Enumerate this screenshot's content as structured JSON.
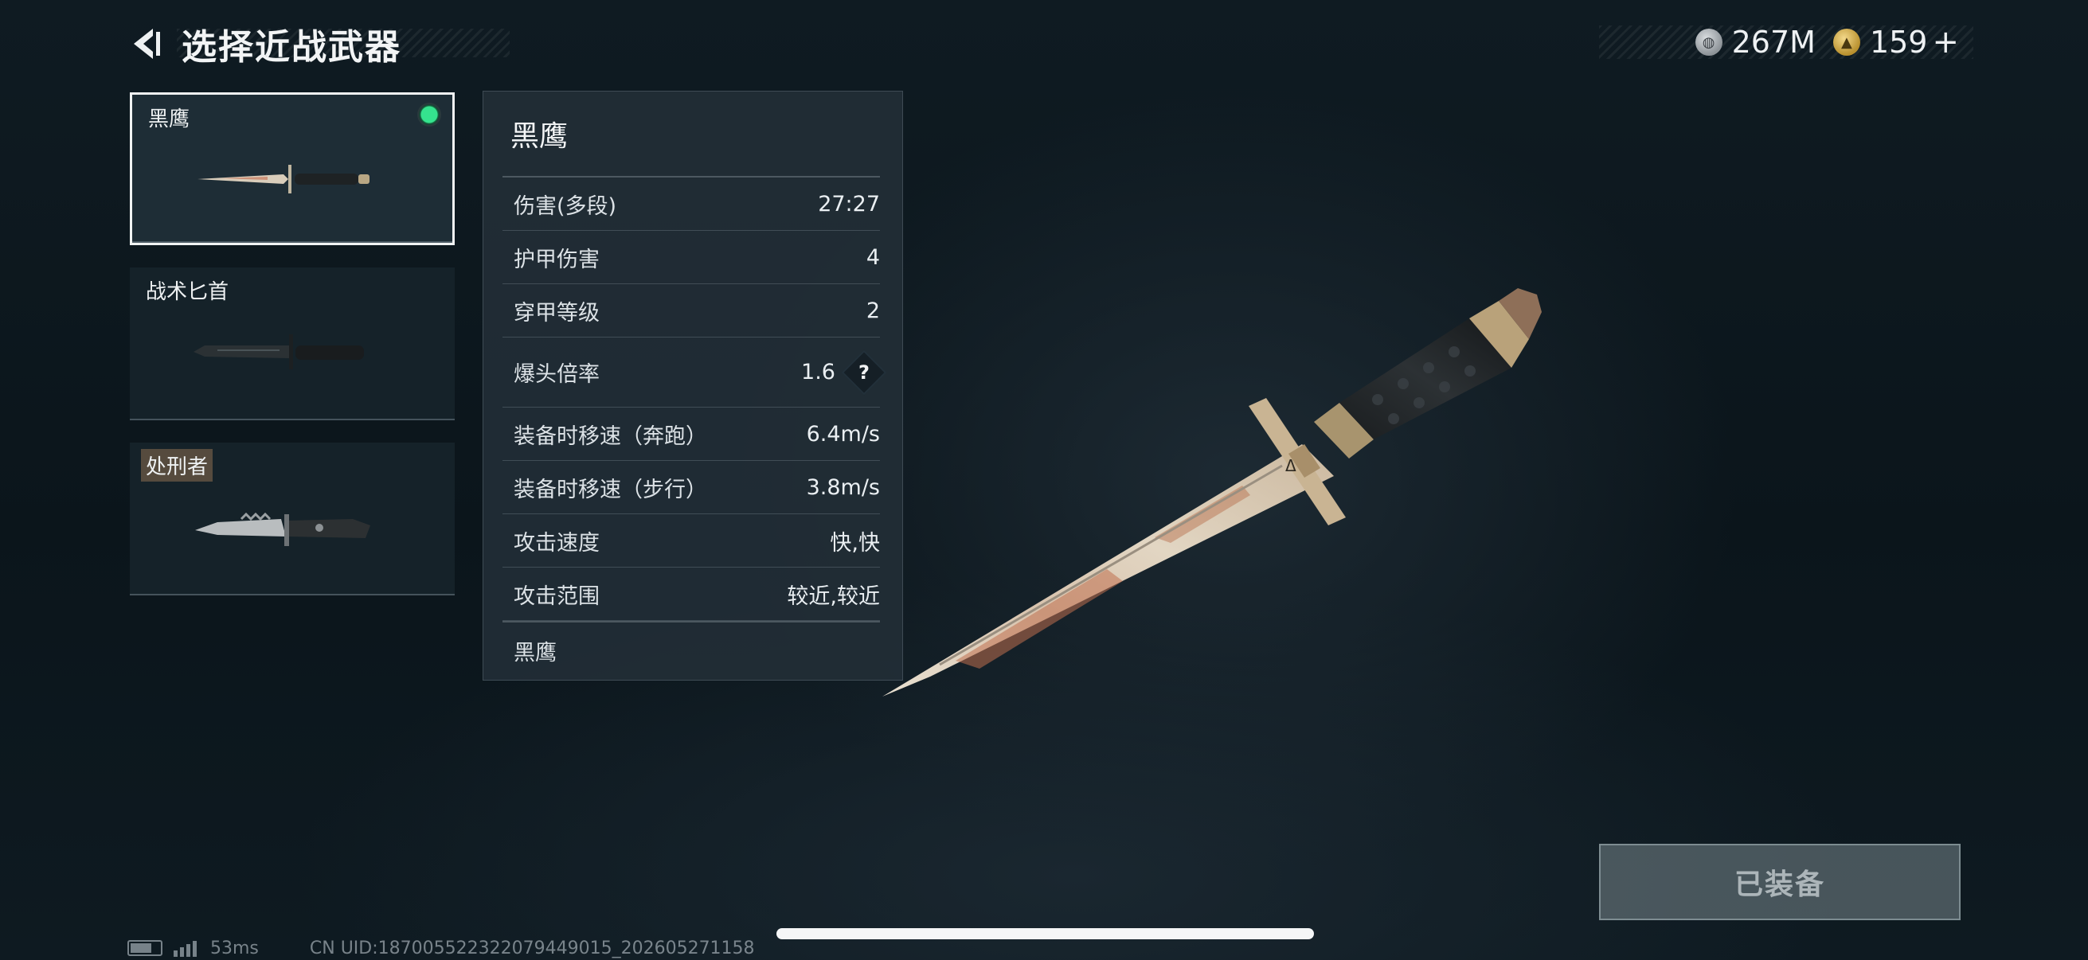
{
  "header": {
    "title": "选择近战武器",
    "currencies": [
      {
        "icon": "silver-coin-icon",
        "value": "267M"
      },
      {
        "icon": "gold-coin-icon",
        "value": "159"
      }
    ],
    "plus_label": "+"
  },
  "weapons": [
    {
      "name": "黑鹰",
      "selected": true,
      "equipped": true
    },
    {
      "name": "战术匕首",
      "selected": false,
      "equipped": false
    },
    {
      "name": "处刑者",
      "selected": false,
      "equipped": false
    }
  ],
  "stats": {
    "title": "黑鹰",
    "rows": [
      {
        "label": "伤害(多段)",
        "value": "27:27"
      },
      {
        "label": "护甲伤害",
        "value": "4"
      },
      {
        "label": "穿甲等级",
        "value": "2"
      },
      {
        "label": "爆头倍率",
        "value": "1.6"
      },
      {
        "label": "装备时移速（奔跑）",
        "value": "6.4m/s"
      },
      {
        "label": "装备时移速（步行）",
        "value": "3.8m/s"
      },
      {
        "label": "攻击速度",
        "value": "快,快"
      },
      {
        "label": "攻击范围",
        "value": "较近,较近"
      }
    ],
    "help_label": "?",
    "description": "黑鹰"
  },
  "equip_button": {
    "label": "已装备"
  },
  "status_bar": {
    "ping": "53ms",
    "uid": "CN UID:1870055223220794490​15_202605271158"
  }
}
